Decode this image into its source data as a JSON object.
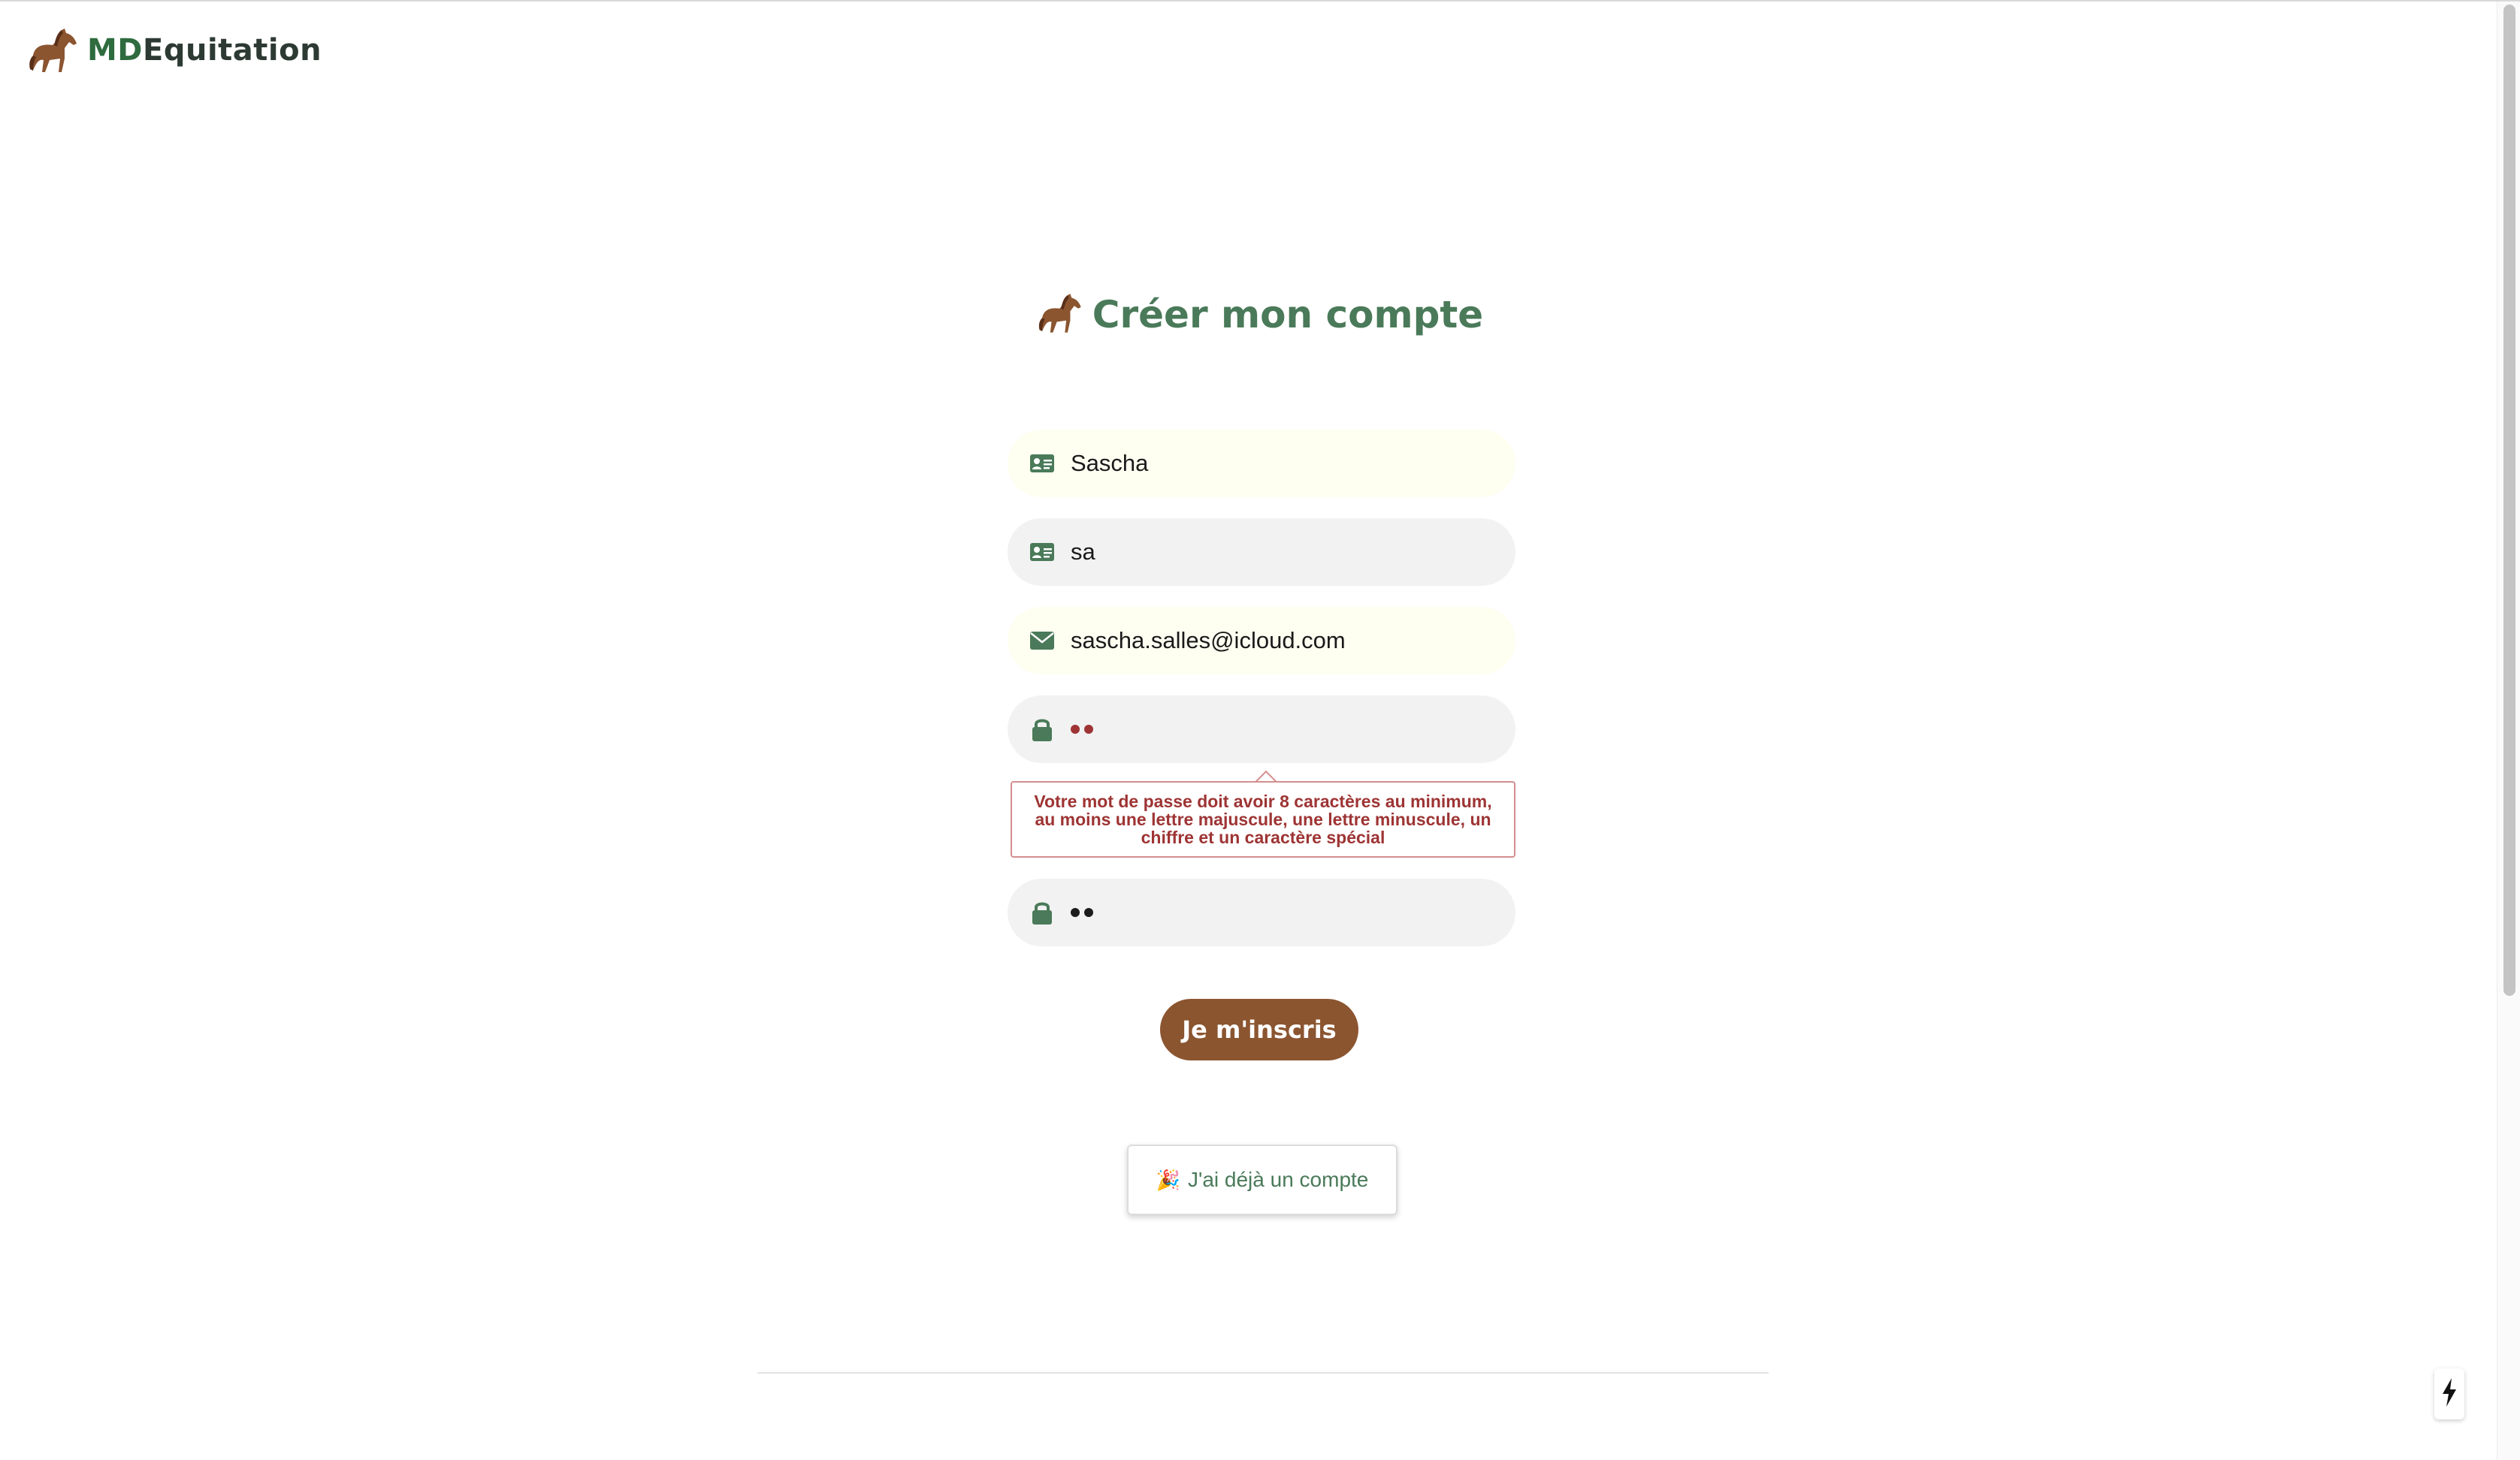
{
  "header": {
    "brand_prefix": "MD",
    "brand_suffix": "Equitation",
    "logo_icon": "horse-icon"
  },
  "main": {
    "title": "Créer mon compte",
    "title_icon": "horse-icon"
  },
  "form": {
    "first_name": {
      "value": "Sascha",
      "icon": "id-card-icon",
      "autofilled": true
    },
    "last_name": {
      "value": "sa",
      "icon": "id-card-icon",
      "autofilled": false
    },
    "email": {
      "value": "sascha.salles@icloud.com",
      "icon": "envelope-icon",
      "autofilled": true
    },
    "password": {
      "masked_length": 2,
      "icon": "lock-icon",
      "invalid": true
    },
    "password_confirm": {
      "masked_length": 2,
      "icon": "lock-icon"
    },
    "password_error": "Votre mot de passe doit avoir 8 caractères au minimum, au moins une lettre majuscule, une lettre minuscule, un chiffre et un caractère spécial",
    "submit_label": "Je m'inscris",
    "login_link_emoji": "🎉",
    "login_link_label": "J'ai déjà un compte"
  },
  "colors": {
    "brand_green": "#2e6b3f",
    "title_green": "#4a7a59",
    "submit_brown": "#8b5530",
    "error_red": "#9e3434"
  }
}
